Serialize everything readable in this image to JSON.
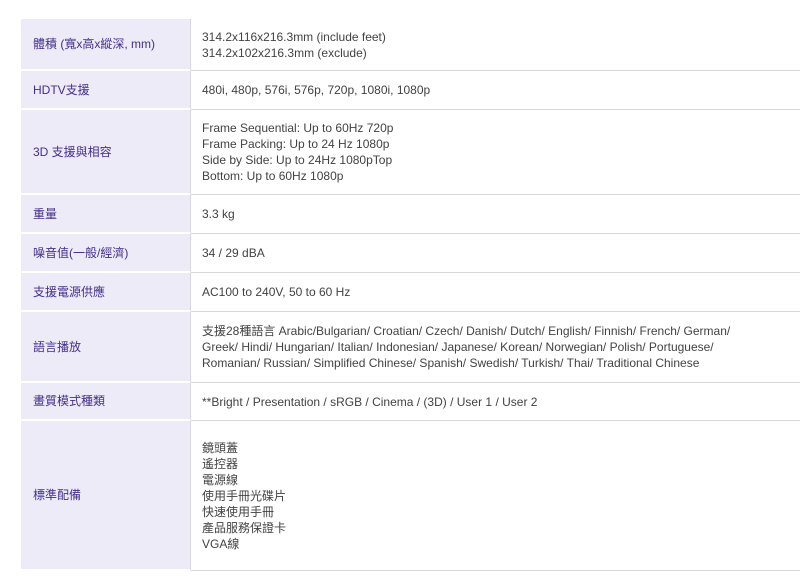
{
  "specs": [
    {
      "label": "體積 (寬x高x縱深, mm)",
      "lines": [
        "314.2x116x216.3mm (include feet)",
        "314.2x102x216.3mm (exclude)"
      ]
    },
    {
      "label": "HDTV支援",
      "lines": [
        "480i, 480p, 576i, 576p, 720p, 1080i, 1080p"
      ]
    },
    {
      "label": "3D 支援與相容",
      "lines": [
        "Frame Sequential: Up to 60Hz 720p",
        "Frame Packing: Up to 24 Hz 1080p",
        "Side by Side: Up to 24Hz 1080pTop",
        "Bottom: Up to 60Hz 1080p"
      ]
    },
    {
      "label": "重量",
      "lines": [
        "3.3 kg"
      ]
    },
    {
      "label": "噪音值(一般/經濟)",
      "lines": [
        "34 / 29 dBA"
      ]
    },
    {
      "label": "支援電源供應",
      "lines": [
        "AC100 to 240V, 50 to 60 Hz"
      ]
    },
    {
      "label": "語言播放",
      "lines": [
        "支援28種語言 Arabic/Bulgarian/ Croatian/ Czech/ Danish/ Dutch/ English/ Finnish/ French/ German/",
        "Greek/ Hindi/ Hungarian/ Italian/ Indonesian/ Japanese/ Korean/ Norwegian/ Polish/ Portuguese/",
        "Romanian/ Russian/ Simplified Chinese/ Spanish/ Swedish/ Turkish/ Thai/ Traditional Chinese"
      ]
    },
    {
      "label": "畫質模式種類",
      "lines": [
        "**Bright / Presentation / sRGB / Cinema / (3D) / User 1 / User 2"
      ]
    },
    {
      "label": "標準配備",
      "lines": [
        "鏡頭蓋",
        "遙控器",
        "電源線",
        "使用手冊光碟片",
        "快速使用手冊",
        "產品服務保證卡",
        "VGA線"
      ]
    }
  ]
}
